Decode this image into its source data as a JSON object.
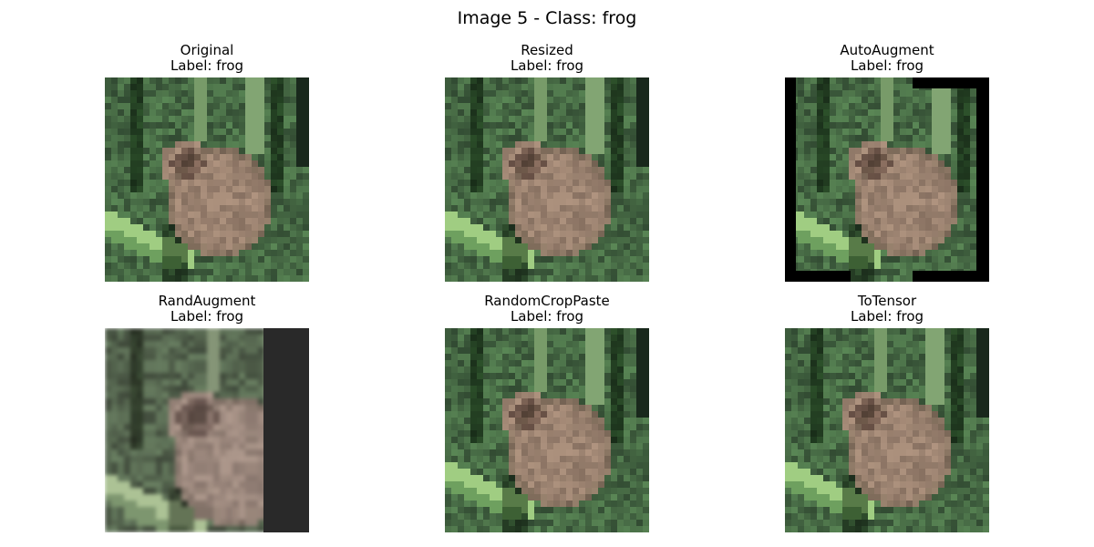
{
  "figure": {
    "title": "Image 5 - Class: frog"
  },
  "panels": [
    {
      "name": "Original",
      "label": "Label: frog",
      "variant": "original"
    },
    {
      "name": "Resized",
      "label": "Label: frog",
      "variant": "resized"
    },
    {
      "name": "AutoAugment",
      "label": "Label: frog",
      "variant": "autoaugment"
    },
    {
      "name": "RandAugment",
      "label": "Label: frog",
      "variant": "randaugment"
    },
    {
      "name": "RandomCropPaste",
      "label": "Label: frog",
      "variant": "randomcroppaste"
    },
    {
      "name": "ToTensor",
      "label": "Label: frog",
      "variant": "totensor"
    }
  ],
  "colors": {
    "background_green": "#4f7448",
    "leaf_light": "#8fbf7f",
    "frog_brown": "#a38b79",
    "dark_shadow": "#1d2b1e",
    "rand_bar": "#292929"
  }
}
